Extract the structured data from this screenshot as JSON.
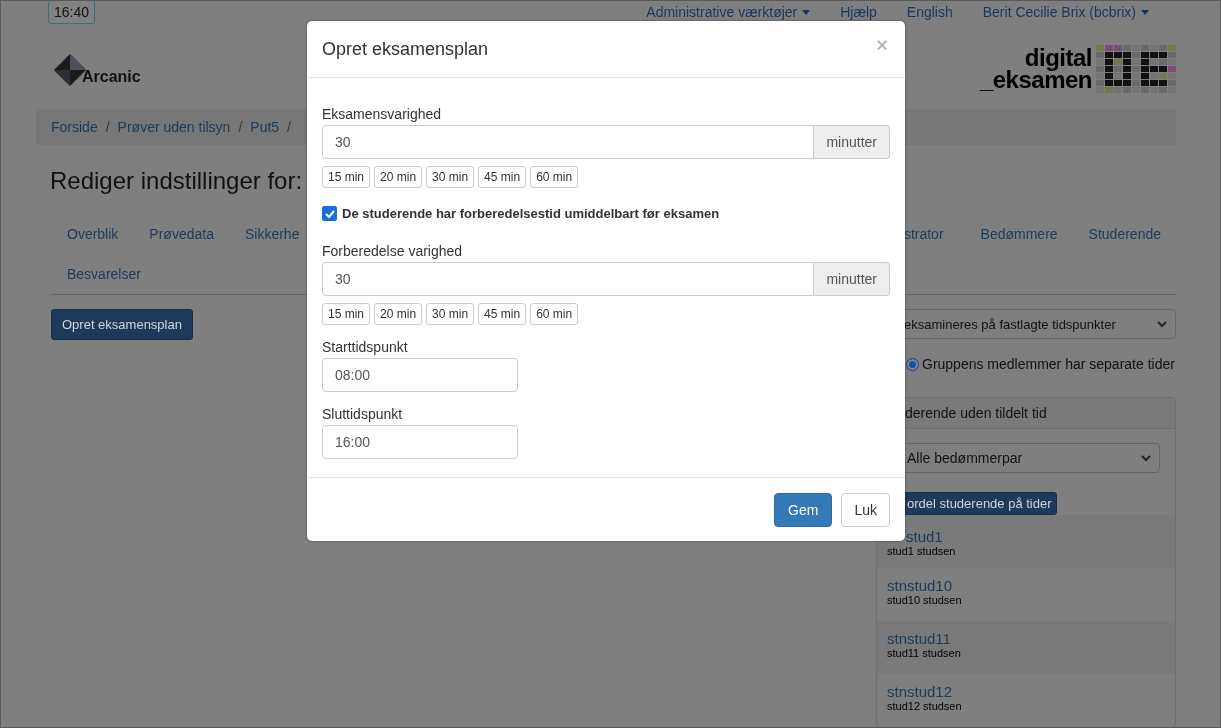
{
  "top_bar": {
    "time": "16:40",
    "nav": [
      {
        "label": "Administrative værktøjer",
        "dropdown": true
      },
      {
        "label": "Hjælp",
        "dropdown": false
      },
      {
        "label": "English",
        "dropdown": false
      },
      {
        "label": "Berit Cecilie Brix (bcbrix)",
        "dropdown": true
      }
    ]
  },
  "logos": {
    "left": "Arcanic",
    "right_line_1": "digital",
    "right_line_2": "_eksamen"
  },
  "breadcrumb": {
    "separator": "/",
    "items": [
      "Forside",
      "Prøver uden tilsyn",
      "Put5"
    ]
  },
  "heading": "Rediger indstillinger for:",
  "tabs": [
    {
      "label": "Overblik",
      "selected": false
    },
    {
      "label": "Prøvedata",
      "selected": false
    },
    {
      "label": "Sikkerhe",
      "selected": false
    },
    {
      "label": "strator",
      "selected": false
    },
    {
      "label": "Bedømmere",
      "selected": false
    },
    {
      "label": "Studerende",
      "selected": false
    },
    {
      "label": "Besvarelser",
      "selected": false
    }
  ],
  "create_button": "Opret eksamensplan",
  "side": {
    "mode_select": "eksamineres på fastlagte tidspunkter",
    "radio": {
      "label": "Gruppens medlemmer har separate tider",
      "checked": true
    },
    "panel_title": "derende uden tildelt tid",
    "pair_select": "Alle bedømmerpar",
    "assign_button": "ordel studerende på tider",
    "students": [
      {
        "id": "stud1",
        "name": "stud1 studsen"
      },
      {
        "id": "stnstud10",
        "name": "stud10 studsen"
      },
      {
        "id": "stnstud11",
        "name": "stud11 studsen"
      },
      {
        "id": "stnstud12",
        "name": "stud12 studsen"
      }
    ]
  },
  "modal": {
    "title": "Opret eksamensplan",
    "close": "×",
    "duration": {
      "label": "Eksamensvarighed",
      "value": "30",
      "addon": "minutter",
      "presets": [
        "15 min",
        "20 min",
        "30 min",
        "45 min",
        "60 min"
      ]
    },
    "prep_checkbox": {
      "label": "De studerende har forberedelsestid umiddelbart før eksamen",
      "checked": true
    },
    "prep": {
      "label": "Forberedelse varighed",
      "value": "30",
      "addon": "minutter",
      "presets": [
        "15 min",
        "20 min",
        "30 min",
        "45 min",
        "60 min"
      ]
    },
    "start": {
      "label": "Starttidspunkt",
      "value": "08:00"
    },
    "end": {
      "label": "Sluttidspunkt",
      "value": "16:00"
    },
    "buttons": [
      {
        "label": "Gem",
        "kind": "primary"
      },
      {
        "label": "Luk",
        "kind": "default"
      }
    ]
  }
}
